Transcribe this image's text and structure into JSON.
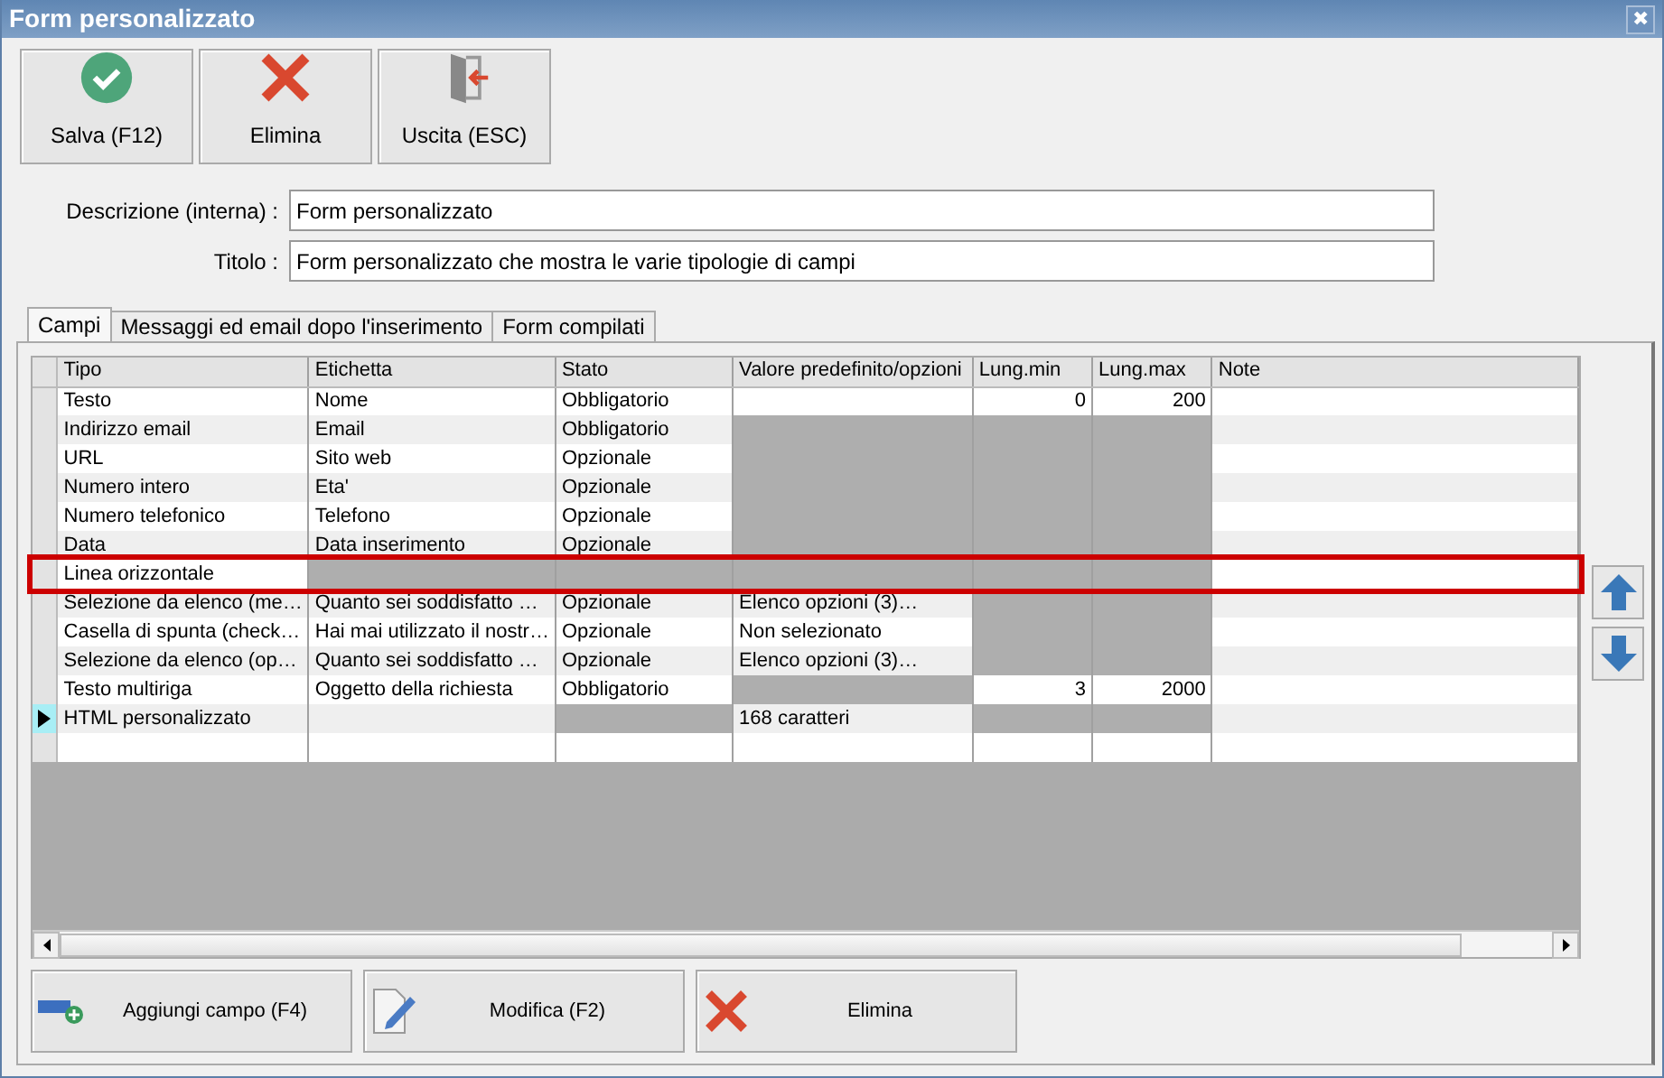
{
  "window": {
    "title": "Form personalizzato",
    "close": "✖"
  },
  "toolbar": [
    {
      "label": "Salva (F12)",
      "kind": "save"
    },
    {
      "label": "Elimina",
      "kind": "delete"
    },
    {
      "label": "Uscita (ESC)",
      "kind": "exit"
    }
  ],
  "fields": [
    {
      "label": "Descrizione (interna) :",
      "value": "Form personalizzato"
    },
    {
      "label": "Titolo :",
      "value": "Form personalizzato che mostra le varie tipologie di campi"
    }
  ],
  "tabs": [
    {
      "label": "Campi",
      "selected": true
    },
    {
      "label": "Messaggi ed email dopo l'inserimento",
      "selected": false
    },
    {
      "label": "Form compilati",
      "selected": false
    }
  ],
  "grid": {
    "columns": [
      {
        "label": "Tipo",
        "kind": "text"
      },
      {
        "label": "Etichetta",
        "kind": "text"
      },
      {
        "label": "Stato",
        "kind": "text"
      },
      {
        "label": "Valore predefinito/opzioni",
        "kind": "text"
      },
      {
        "label": "Lung.min",
        "kind": "number"
      },
      {
        "label": "Lung.max",
        "kind": "number"
      },
      {
        "label": "Note",
        "kind": "text"
      }
    ],
    "rows": [
      {
        "selected": false,
        "highlighted": false,
        "cells": [
          {
            "text": "Testo",
            "disabled": false
          },
          {
            "text": "Nome",
            "disabled": false
          },
          {
            "text": "Obbligatorio",
            "disabled": false
          },
          {
            "disabled": false
          },
          {
            "text": "0",
            "disabled": false
          },
          {
            "text": "200",
            "disabled": false
          },
          {
            "disabled": false
          }
        ]
      },
      {
        "selected": false,
        "highlighted": false,
        "cells": [
          {
            "text": "Indirizzo email",
            "disabled": false
          },
          {
            "text": "Email",
            "disabled": false
          },
          {
            "text": "Obbligatorio",
            "disabled": false
          },
          {
            "disabled": true
          },
          {
            "disabled": true
          },
          {
            "disabled": true
          },
          {
            "disabled": false
          }
        ]
      },
      {
        "selected": false,
        "highlighted": false,
        "cells": [
          {
            "text": "URL",
            "disabled": false
          },
          {
            "text": "Sito web",
            "disabled": false
          },
          {
            "text": "Opzionale",
            "disabled": false
          },
          {
            "disabled": true
          },
          {
            "disabled": true
          },
          {
            "disabled": true
          },
          {
            "disabled": false
          }
        ]
      },
      {
        "selected": false,
        "highlighted": false,
        "cells": [
          {
            "text": "Numero intero",
            "disabled": false
          },
          {
            "text": "Eta'",
            "disabled": false
          },
          {
            "text": "Opzionale",
            "disabled": false
          },
          {
            "disabled": true
          },
          {
            "disabled": true
          },
          {
            "disabled": true
          },
          {
            "disabled": false
          }
        ]
      },
      {
        "selected": false,
        "highlighted": false,
        "cells": [
          {
            "text": "Numero telefonico",
            "disabled": false
          },
          {
            "text": "Telefono",
            "disabled": false
          },
          {
            "text": "Opzionale",
            "disabled": false
          },
          {
            "disabled": true
          },
          {
            "disabled": true
          },
          {
            "disabled": true
          },
          {
            "disabled": false
          }
        ]
      },
      {
        "selected": false,
        "highlighted": false,
        "cells": [
          {
            "text": "Data",
            "disabled": false
          },
          {
            "text": "Data inserimento",
            "disabled": false
          },
          {
            "text": "Opzionale",
            "disabled": false
          },
          {
            "disabled": true
          },
          {
            "disabled": true
          },
          {
            "disabled": true
          },
          {
            "disabled": false
          }
        ]
      },
      {
        "selected": false,
        "highlighted": true,
        "cells": [
          {
            "text": "Linea orizzontale",
            "disabled": false
          },
          {
            "disabled": true
          },
          {
            "disabled": true
          },
          {
            "disabled": true
          },
          {
            "disabled": true
          },
          {
            "disabled": true
          },
          {
            "disabled": false
          }
        ]
      },
      {
        "selected": false,
        "highlighted": false,
        "cells": [
          {
            "text": "Selezione da elenco (me…",
            "disabled": false
          },
          {
            "text": "Quanto sei soddisfatto …",
            "disabled": false
          },
          {
            "text": "Opzionale",
            "disabled": false
          },
          {
            "text": "Elenco opzioni (3)…",
            "disabled": false
          },
          {
            "disabled": true
          },
          {
            "disabled": true
          },
          {
            "disabled": false
          }
        ]
      },
      {
        "selected": false,
        "highlighted": false,
        "cells": [
          {
            "text": "Casella di spunta (check…",
            "disabled": false
          },
          {
            "text": "Hai mai utilizzato il nostr…",
            "disabled": false
          },
          {
            "text": "Opzionale",
            "disabled": false
          },
          {
            "text": "Non selezionato",
            "disabled": false
          },
          {
            "disabled": true
          },
          {
            "disabled": true
          },
          {
            "disabled": false
          }
        ]
      },
      {
        "selected": false,
        "highlighted": false,
        "cells": [
          {
            "text": "Selezione da elenco (op…",
            "disabled": false
          },
          {
            "text": "Quanto sei soddisfatto …",
            "disabled": false
          },
          {
            "text": "Opzionale",
            "disabled": false
          },
          {
            "text": "Elenco opzioni (3)…",
            "disabled": false
          },
          {
            "disabled": true
          },
          {
            "disabled": true
          },
          {
            "disabled": false
          }
        ]
      },
      {
        "selected": false,
        "highlighted": false,
        "cells": [
          {
            "text": "Testo multiriga",
            "disabled": false
          },
          {
            "text": "Oggetto della richiesta",
            "disabled": false
          },
          {
            "text": "Obbligatorio",
            "disabled": false
          },
          {
            "disabled": true
          },
          {
            "text": "3",
            "disabled": false
          },
          {
            "text": "2000",
            "disabled": false
          },
          {
            "disabled": false
          }
        ]
      },
      {
        "selected": true,
        "highlighted": false,
        "cells": [
          {
            "text": "HTML personalizzato",
            "disabled": false
          },
          {
            "disabled": false
          },
          {
            "disabled": true
          },
          {
            "text": "168 caratteri",
            "disabled": false
          },
          {
            "disabled": true
          },
          {
            "disabled": true
          },
          {
            "disabled": false
          }
        ]
      },
      {
        "selected": false,
        "highlighted": false,
        "cells": [
          {
            "disabled": false
          },
          {
            "disabled": false
          },
          {
            "disabled": false
          },
          {
            "disabled": false
          },
          {
            "disabled": false
          },
          {
            "disabled": false
          },
          {
            "disabled": false
          }
        ]
      }
    ]
  },
  "bottom_buttons": [
    {
      "label": "Aggiungi campo (F4)",
      "kind": "add"
    },
    {
      "label": "Modifica (F2)",
      "kind": "edit"
    },
    {
      "label": "Elimina",
      "kind": "delete"
    }
  ]
}
